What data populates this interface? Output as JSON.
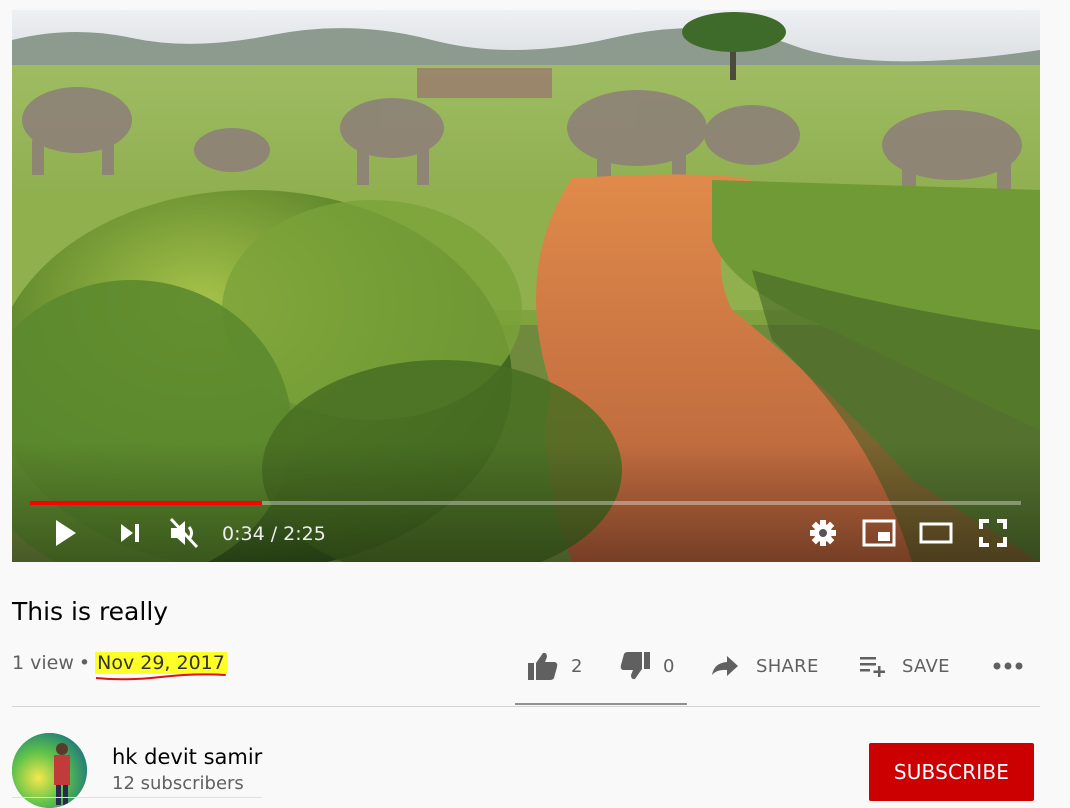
{
  "player": {
    "current_time": "0:34",
    "duration": "2:25",
    "played_fraction": 0.234,
    "buffered_fraction": 0.234,
    "accent_color": "#ff0000"
  },
  "controls": {
    "left": [
      "play-icon",
      "next-icon",
      "volume-muted-icon"
    ],
    "right": [
      "settings-gear-icon",
      "miniplayer-icon",
      "theater-mode-icon",
      "fullscreen-icon"
    ]
  },
  "video": {
    "title": "This is really",
    "views": "1 view",
    "separator": "•",
    "date": "Nov 29, 2017",
    "date_highlight_color": "#ffff28"
  },
  "actions": {
    "like_count": "2",
    "dislike_count": "0",
    "share_label": "SHARE",
    "save_label": "SAVE",
    "more_icon": "more-horizontal-icon"
  },
  "channel": {
    "name": "hk devit samir",
    "subscribers": "12 subscribers",
    "subscribe_label": "SUBSCRIBE",
    "subscribe_color": "#cc0000"
  }
}
